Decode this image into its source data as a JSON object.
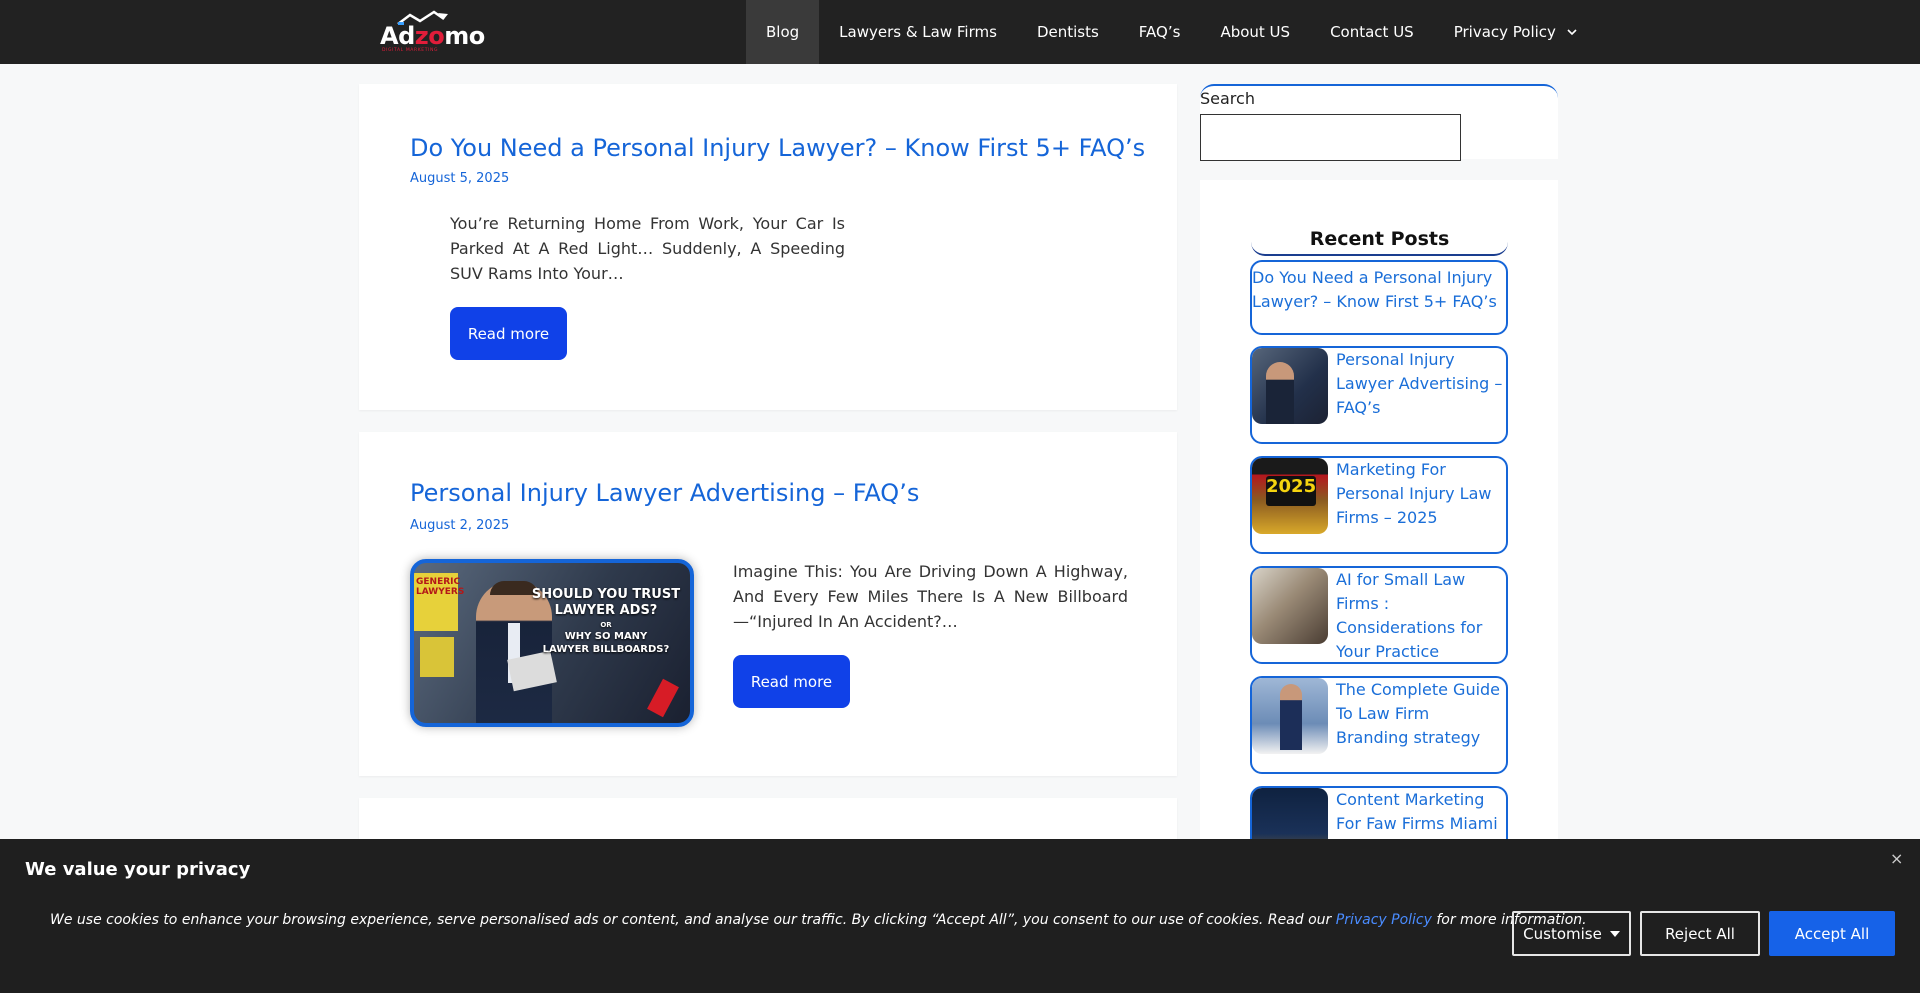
{
  "header": {
    "logo": {
      "prefix": "Ad",
      "accent": "zo",
      "suffix": "mo",
      "tagline": "DIGITAL MARKETING"
    },
    "nav": [
      {
        "label": "Blog",
        "active": true
      },
      {
        "label": "Lawyers & Law Firms"
      },
      {
        "label": "Dentists"
      },
      {
        "label": "FAQ’s"
      },
      {
        "label": "About US"
      },
      {
        "label": "Contact US"
      },
      {
        "label": "Privacy Policy",
        "icon": "chevron-down-icon"
      }
    ]
  },
  "posts": [
    {
      "title": "Do You Need a Personal Injury Lawyer? – Know First 5+ FAQ’s",
      "date": "August 5, 2025",
      "excerpt": "You’re Returning Home From Work, Your Car Is Parked At A Red Light… Suddenly, A Speeding SUV Rams Into Your…",
      "read_more": "Read more"
    },
    {
      "title": "Personal Injury Lawyer Advertising – FAQ’s",
      "date": "August 2, 2025",
      "excerpt": "Imagine This: You Are Driving Down A Highway, And Every Few Miles There Is A New Billboard —“Injured In An Accident?…",
      "read_more": "Read more",
      "image_text": {
        "sign": "GENERIC LAWYERS",
        "line1": "SHOULD YOU TRUST",
        "line2": "LAWYER ADS?",
        "line3": "OR",
        "line4": "WHY SO MANY",
        "line5": "LAWYER BILLBOARDS?"
      }
    }
  ],
  "sidebar": {
    "search_label": "Search",
    "search_value": "",
    "recent_heading": "Recent Posts",
    "recent_posts": [
      {
        "title": "Do You Need a Personal Injury Lawyer? – Know First 5+ FAQ’s"
      },
      {
        "title": "Personal Injury Lawyer Advertising – FAQ’s"
      },
      {
        "title": "Marketing For Personal Injury Law Firms – 2025",
        "image_text": "2025"
      },
      {
        "title": "AI for Small Law Firms : Considerations for Your Practice"
      },
      {
        "title": "The Complete Guide To Law Firm Branding strategy"
      },
      {
        "title": "Content Marketing For Faw Firms Miami fl"
      }
    ]
  },
  "cookie": {
    "title": "We value your privacy",
    "text_before": "We use cookies to enhance your browsing experience, serve personalised ads or content, and analyse our traffic. By clicking “Accept All”, you consent to our use of cookies. Read our ",
    "link": "Privacy Policy",
    "text_after": " for more information.",
    "close": "×",
    "buttons": {
      "customise": "Customise",
      "reject": "Reject All",
      "accept": "Accept All"
    }
  },
  "colors": {
    "accent": "#1565d8",
    "button": "#1041e8",
    "header_bg": "#222222",
    "cookie_bg": "#1f1f1f"
  }
}
